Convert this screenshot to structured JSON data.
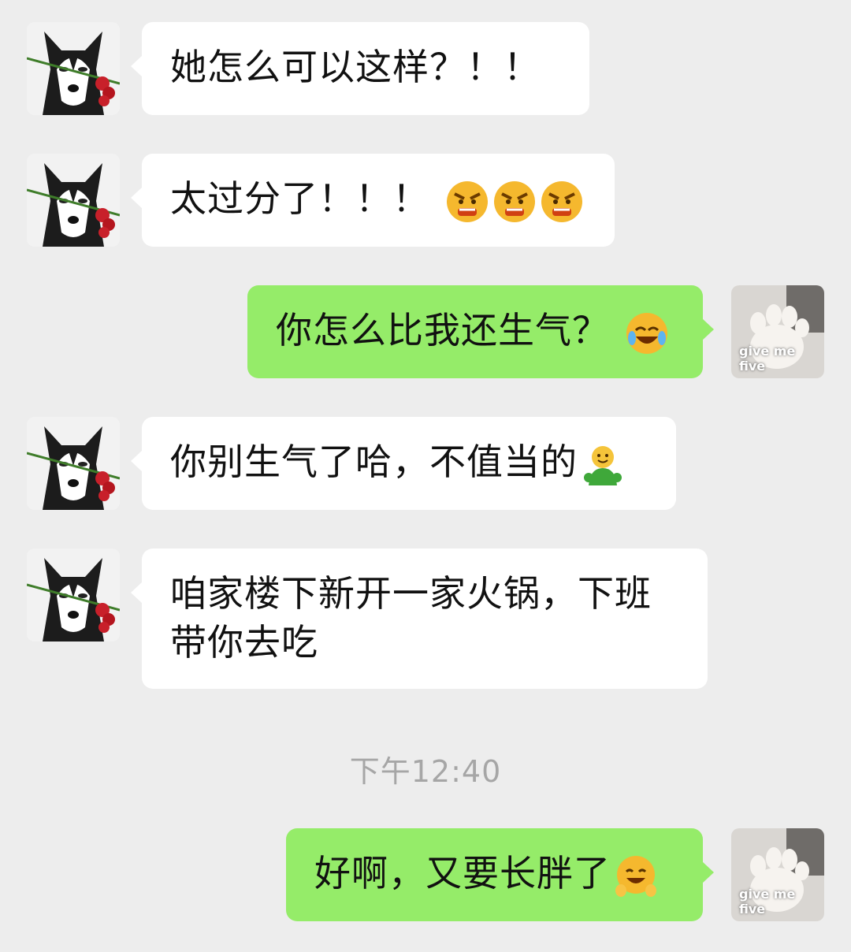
{
  "chat": {
    "messages": [
      {
        "side": "left",
        "text": "她怎么可以这样？！！",
        "emojis": []
      },
      {
        "side": "left",
        "text": "太过分了！！！",
        "emojis": [
          "angry-face-icon",
          "angry-face-icon",
          "angry-face-icon"
        ]
      },
      {
        "side": "right",
        "text": "你怎么比我还生气？",
        "emojis": [
          "laughing-crying-face-icon"
        ]
      },
      {
        "side": "left",
        "text": "你别生气了哈，不值当的",
        "emojis": [
          "green-smiley-figure-icon"
        ]
      },
      {
        "side": "left",
        "line1": "咱家楼下新开一家火锅，下班",
        "line2": "带你去吃",
        "emojis": []
      },
      {
        "side": "right",
        "text": "好啊，又要长胖了",
        "emojis": [
          "smiling-hands-face-icon"
        ]
      }
    ],
    "timestamp": "下午12:40",
    "my_avatar_caption": "give me five"
  },
  "colors": {
    "background": "#ededed",
    "incoming_bubble": "#ffffff",
    "outgoing_bubble": "#95ec69",
    "timestamp_text": "#a6a6a6"
  }
}
